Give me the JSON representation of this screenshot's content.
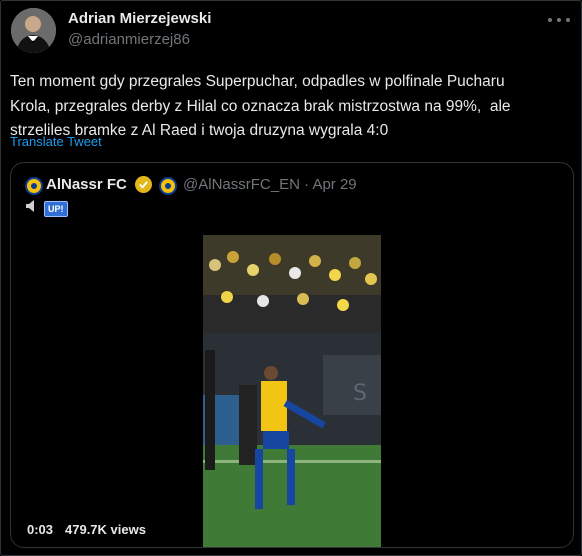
{
  "tweet": {
    "author_name": "Adrian Mierzejewski",
    "author_handle": "@adrianmierzej86",
    "text": "Ten moment gdy przegrales Superpuchar, odpadles w polfinale Pucharu\nKrola, przegrales derby z Hilal co oznacza brak mistrzostwa na 99%,  ale\nstrzeliles bramke z Al Raed i twoja druzyna wygrala 4:0",
    "translate_label": "Translate Tweet"
  },
  "quote": {
    "name": "AlNassr FC",
    "handle": "@AlNassrFC_EN",
    "separator": "·",
    "date": "Apr 29",
    "badge": "UP!",
    "video_time": "0:03",
    "views": "479.7K views"
  },
  "colors": {
    "background": "#000000",
    "text": "#e7e9ea",
    "muted": "#71767b",
    "link": "#1d9bf0",
    "border": "#2f3336",
    "verified_gold": "#e2b719"
  },
  "icons": [
    "more-icon",
    "verified-badge-icon",
    "club-logo-icon",
    "speaker-icon"
  ]
}
